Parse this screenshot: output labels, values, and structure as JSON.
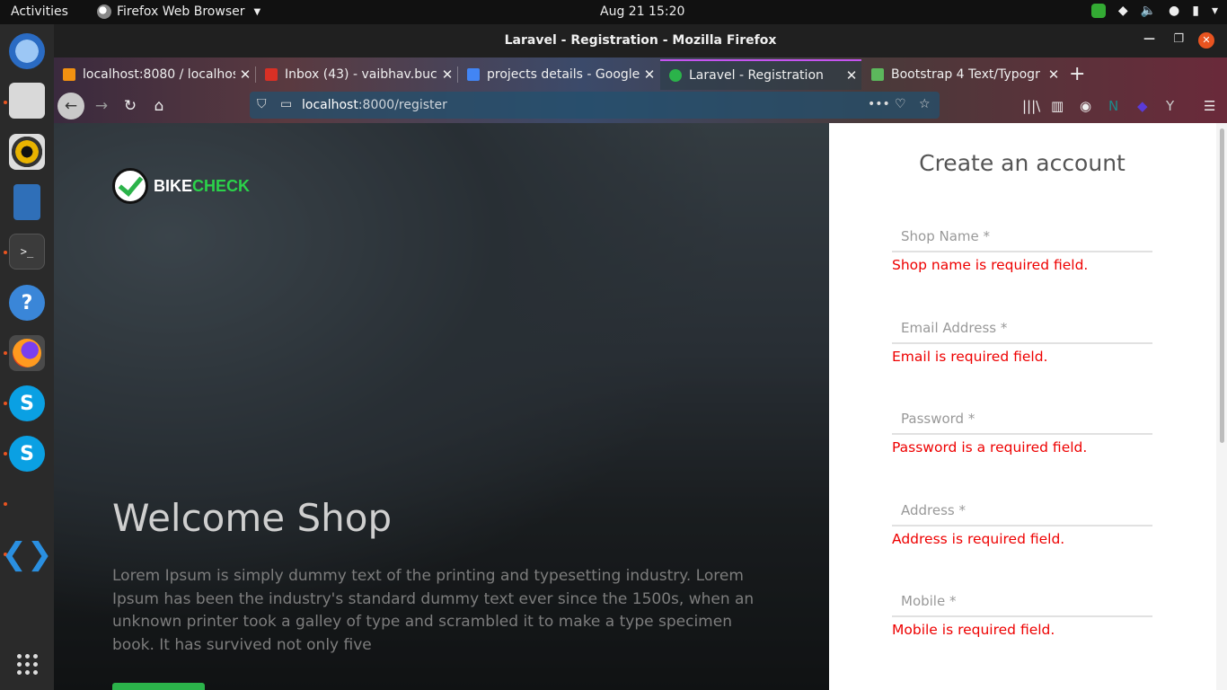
{
  "topbar": {
    "activities": "Activities",
    "app_name": "Firefox Web Browser",
    "clock": "Aug 21  15:20"
  },
  "dock": {
    "items": [
      "thunderbird-mail",
      "files",
      "rhythmbox",
      "libreoffice-writer",
      "terminal",
      "help",
      "firefox",
      "skype",
      "skype",
      "vscode",
      "show-applications"
    ]
  },
  "window": {
    "title": "Laravel - Registration - Mozilla Firefox"
  },
  "tabs": [
    {
      "label": "localhost:8080 / localhost",
      "favicon_color": "#f29111"
    },
    {
      "label": "Inbox (43) - vaibhav.bucc",
      "favicon_color": "#d93025"
    },
    {
      "label": "projects details - Google",
      "favicon_color": "#4285f4"
    },
    {
      "label": "Laravel - Registration",
      "favicon_color": "#2bb34a"
    },
    {
      "label": "Bootstrap 4 Text/Typogr",
      "favicon_color": "#5cb85c"
    }
  ],
  "urlbar": {
    "host": "localhost",
    "path": ":8000/register"
  },
  "hero": {
    "brand_part1": "BIKE",
    "brand_part2": "CHECK",
    "title": "Welcome Shop",
    "text": "Lorem Ipsum is simply dummy text of the printing and typesetting industry. Lorem Ipsum has been the industry's standard dummy text ever since the 1500s, when an unknown printer took a galley of type and scrambled it to make a type specimen book. It has survived not only five"
  },
  "form": {
    "title": "Create an account",
    "fields": [
      {
        "placeholder": "Shop Name *",
        "value": "",
        "error": "Shop name is required field."
      },
      {
        "placeholder": "Email Address *",
        "value": "",
        "error": "Email is required field."
      },
      {
        "placeholder": "Password *",
        "value": "",
        "error": "Password is a required field."
      },
      {
        "placeholder": "Address *",
        "value": "",
        "error": "Address is required field."
      },
      {
        "placeholder": "Mobile *",
        "value": "",
        "error": "Mobile is required field."
      }
    ]
  },
  "colors": {
    "brand_green": "#2bb34a",
    "error_red": "#e00000",
    "active_tab_accent": "#c454f0"
  }
}
